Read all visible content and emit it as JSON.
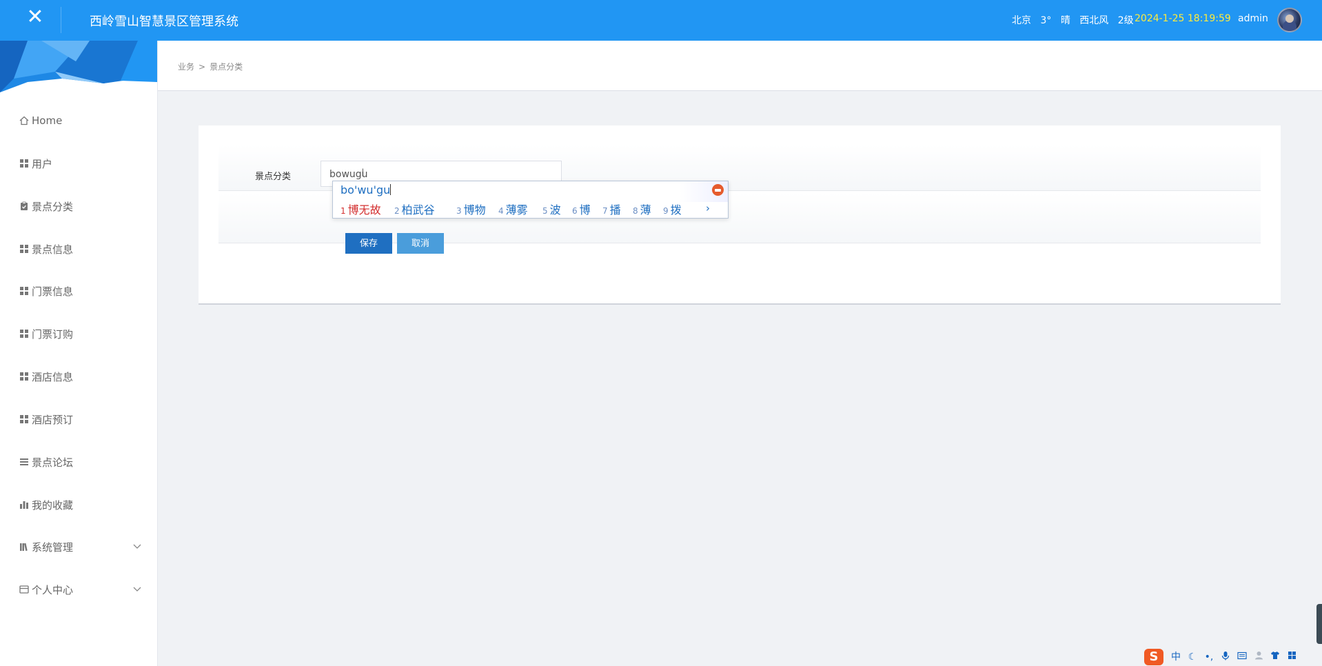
{
  "header": {
    "app_title": "西岭雪山智慧景区管理系统",
    "weather": {
      "city": "北京",
      "temperature": "3°",
      "condition": "晴",
      "wind": "西北风",
      "level": "2级"
    },
    "datetime": "2024-1-25 18:19:59",
    "user": "admin",
    "close_icon": "close-icon"
  },
  "breadcrumb": {
    "parent": "业务",
    "separator": ">",
    "current": "景点分类"
  },
  "sidebar": {
    "items": [
      {
        "label": "Home",
        "icon": "home-icon"
      },
      {
        "label": "用户",
        "icon": "grid-icon"
      },
      {
        "label": "景点分类",
        "icon": "clipboard-icon"
      },
      {
        "label": "景点信息",
        "icon": "grid-icon"
      },
      {
        "label": "门票信息",
        "icon": "grid-icon"
      },
      {
        "label": "门票订购",
        "icon": "grid-icon"
      },
      {
        "label": "酒店信息",
        "icon": "grid-icon"
      },
      {
        "label": "酒店预订",
        "icon": "grid-icon"
      },
      {
        "label": "景点论坛",
        "icon": "list-icon"
      },
      {
        "label": "我的收藏",
        "icon": "bar-chart-icon"
      },
      {
        "label": "系统管理",
        "icon": "books-icon",
        "expandable": true
      },
      {
        "label": "个人中心",
        "icon": "card-icon",
        "expandable": true
      }
    ]
  },
  "form": {
    "field_label": "景点分类",
    "field_value": "bowugu",
    "save_label": "保存",
    "cancel_label": "取消"
  },
  "ime": {
    "composition": "bo'wu'gu",
    "candidates": [
      {
        "num": "1",
        "text": "博无故"
      },
      {
        "num": "2",
        "text": "柏武谷"
      },
      {
        "num": "3",
        "text": "博物"
      },
      {
        "num": "4",
        "text": "薄雾"
      },
      {
        "num": "5",
        "text": "波"
      },
      {
        "num": "6",
        "text": "博"
      },
      {
        "num": "7",
        "text": "播"
      },
      {
        "num": "8",
        "text": "薄"
      },
      {
        "num": "9",
        "text": "拨"
      }
    ],
    "more": "›",
    "status_bar": {
      "logo": "S",
      "mode": "中"
    }
  },
  "colors": {
    "header_bg": "#2196f3",
    "clock": "#ffeb3b",
    "save_btn": "#1f6fc1",
    "cancel_btn": "#4a9ddb",
    "candidate_active": "#d32f2f"
  }
}
